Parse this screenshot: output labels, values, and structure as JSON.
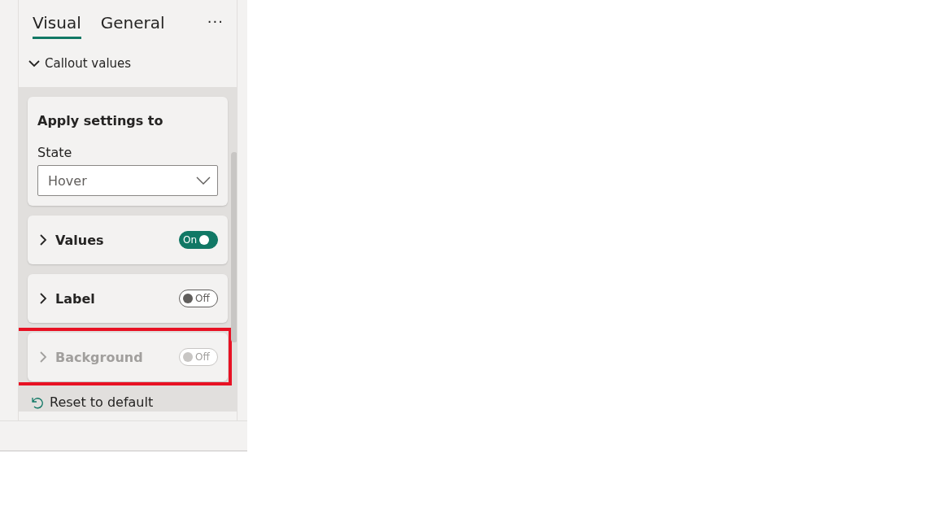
{
  "tabs": [
    {
      "label": "Visual",
      "selected": true
    },
    {
      "label": "General",
      "selected": false
    }
  ],
  "more_button": "···",
  "section": {
    "title": "Callout values",
    "expanded": true
  },
  "cards": [
    {
      "kind": "settings",
      "title": "Apply settings to",
      "field_label": "State",
      "value": "Hover"
    },
    {
      "kind": "toggle",
      "label": "Values",
      "on": true,
      "disabled": false,
      "toggle_text": "On",
      "highlighted": false
    },
    {
      "kind": "toggle",
      "label": "Label",
      "on": false,
      "disabled": false,
      "toggle_text": "Off",
      "highlighted": false
    },
    {
      "kind": "toggle",
      "label": "Background",
      "on": false,
      "disabled": true,
      "toggle_text": "Off",
      "highlighted": true
    }
  ],
  "reset_link": "Reset to default"
}
